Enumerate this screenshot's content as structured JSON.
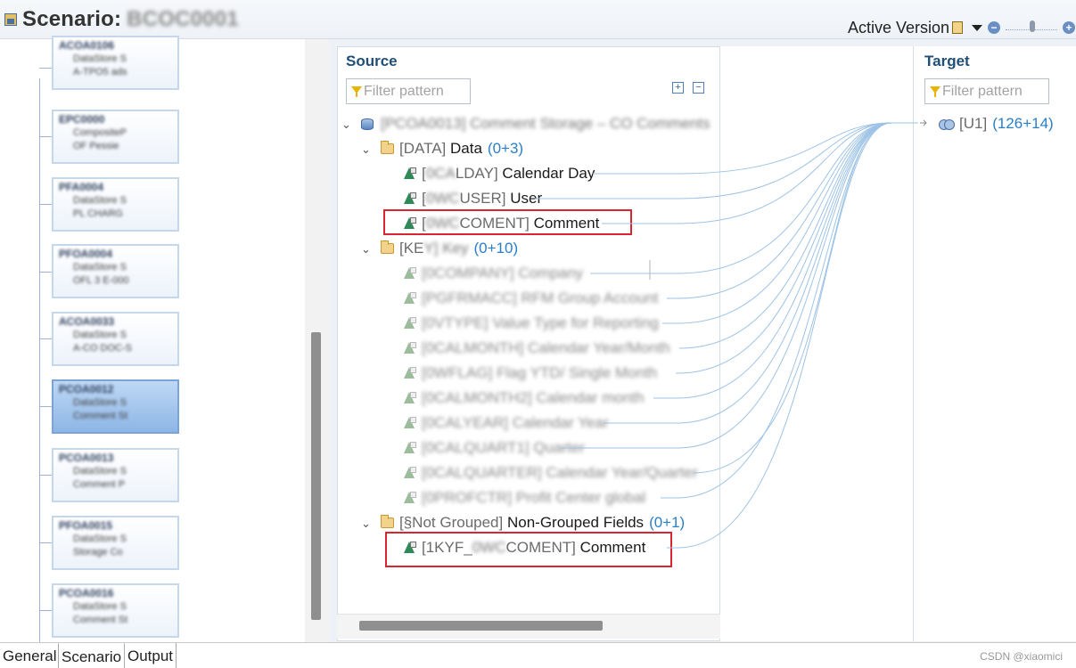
{
  "header": {
    "title_label": "Scenario:",
    "title_name": "BCOC0001",
    "active_version_label": "Active Version",
    "zoom_minus": "−",
    "zoom_plus": "+"
  },
  "left_nodes": [
    {
      "title": "ACOA0106",
      "line1": "DataStore S",
      "line2": "A-TPO5 ads"
    },
    {
      "title": "EPC0000",
      "line1": "CompositeP",
      "line2": "OF Pessie"
    },
    {
      "title": "PFA0004",
      "line1": "DataStore S",
      "line2": "PL CHARG"
    },
    {
      "title": "PFOA0004",
      "line1": "DataStore S",
      "line2": "OFL 3 E-000"
    },
    {
      "title": "ACOA0033",
      "line1": "DataStore S",
      "line2": "A-CO DOC-S"
    },
    {
      "title": "PCOA0012",
      "line1": "DataStore S",
      "line2": "Comment St"
    },
    {
      "title": "PCOA0013",
      "line1": "DataStore S",
      "line2": "Comment P"
    },
    {
      "title": "PFOA0015",
      "line1": "DataStore S",
      "line2": "Storage Co"
    },
    {
      "title": "PCOA0016",
      "line1": "DataStore S",
      "line2": "Comment St"
    }
  ],
  "source": {
    "title": "Source",
    "filter_placeholder": "Filter pattern",
    "root": {
      "tech": "[PCOA0013]",
      "text": "Comment Storage – CO Comments"
    },
    "group_data": {
      "tech": "[DATA]",
      "text": "Data",
      "count": "(0+3)"
    },
    "data_fields": [
      {
        "tech_blur": "0CA",
        "tech_rest": "LDAY]",
        "text": "Calendar Day"
      },
      {
        "tech_blur": "0WC",
        "tech_rest": "USER]",
        "text": "User"
      },
      {
        "tech_blur": "0WC",
        "tech_rest": "COMENT]",
        "text": "Comment"
      }
    ],
    "group_key": {
      "tech_visible": "[KE",
      "tech_blur": "Y]",
      "text_blur": "Key",
      "count": "(0+10)"
    },
    "key_fields": [
      {
        "tech": "[0COMPANY]",
        "text": "Company"
      },
      {
        "tech": "[PGFRMACC]",
        "text": "RFM Group Account"
      },
      {
        "tech": "[0VTYPE]",
        "text": "Value Type for Reporting"
      },
      {
        "tech": "[0CALMONTH]",
        "text": "Calendar Year/Month"
      },
      {
        "tech": "[0WFLAG]",
        "text": "Flag YTD/ Single Month"
      },
      {
        "tech": "[0CALMONTH2]",
        "text": "Calendar month"
      },
      {
        "tech": "[0CALYEAR]",
        "text": "Calendar Year"
      },
      {
        "tech": "[0CALQUART1]",
        "text": "Quarter"
      },
      {
        "tech": "[0CALQUARTER]",
        "text": "Calendar Year/Quarter"
      },
      {
        "tech": "[0PROFCTR]",
        "text": "Profit Center global"
      }
    ],
    "group_ng": {
      "tech": "[§Not Grouped]",
      "text": "Non-Grouped Fields",
      "count": "(0+1)"
    },
    "ng_field": {
      "tech_start": "[1KYF_",
      "tech_blur": "0WC",
      "tech_rest": "COMENT]",
      "text": "Comment"
    }
  },
  "target": {
    "title": "Target",
    "filter_placeholder": "Filter pattern",
    "union_tech": "[U1]",
    "union_count": "(126+14)"
  },
  "tabs": {
    "general": "General",
    "scenario": "Scenario",
    "output": "Output"
  },
  "watermark": "CSDN @xiaomici",
  "colors": {
    "highlight": "#d9262e",
    "accent": "#1f4e79",
    "count": "#2a7fc7",
    "link_lines": "#9ec3e6"
  }
}
